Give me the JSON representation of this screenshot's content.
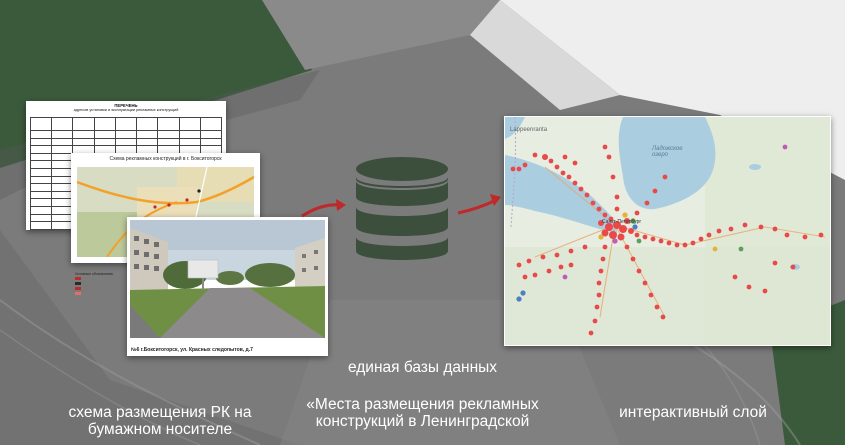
{
  "slide": {
    "colors": {
      "background_gray": "#7c7c7c",
      "dark_green": "#3b5a3c",
      "light_panel": "#eeeeee",
      "icon_green": "#3c4f3c",
      "arrow_red": "#c0282a",
      "map_point_red": "#e84a4a"
    }
  },
  "paper_stack": {
    "table_sheet": {
      "title": "ПЕРЕЧЕНЬ",
      "subtitle": "адресов установки и эксплуатации рекламных конструкций"
    },
    "scheme_sheet": {
      "title": "Схема рекламных конструкций в г. Бокситогорск"
    },
    "photo_sheet": {
      "caption": "№6 г.Бокситогорск, ул. Красных следопытов, д.7"
    },
    "legend": {
      "title": "Условные обозначения"
    }
  },
  "database": {
    "icon": "database-icon",
    "arrow_in": "arrow-right-icon",
    "arrow_out": "arrow-right-icon"
  },
  "map": {
    "label_lappeenranta": "Lappeenranta",
    "label_lake": "Ладожское озеро",
    "label_city": "Санкт-Петербург"
  },
  "captions": {
    "paper": "схема размещения РК на бумажном носителе",
    "db_title": "единая базы данных",
    "db_subtitle": "«Места размещения рекламных конструкций в Ленинградской",
    "map": "интерактивный слой"
  }
}
